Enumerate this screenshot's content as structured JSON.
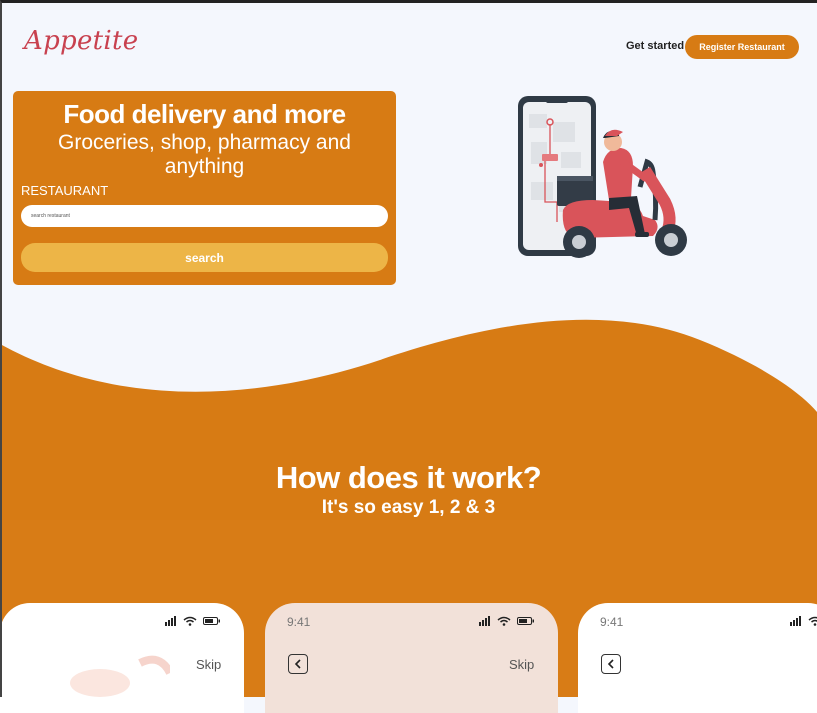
{
  "header": {
    "logo": "Appetite",
    "get_started": "Get started",
    "register_label": "Register Restaurant"
  },
  "hero": {
    "title": "Food delivery and more",
    "subtitle": "Groceries, shop, pharmacy and anything",
    "field_label": "RESTAURANT",
    "search_placeholder": "search restaurant",
    "search_button": "search"
  },
  "how": {
    "title": "How does it work?",
    "subtitle": "It's so easy 1, 2 & 3"
  },
  "phones": [
    {
      "time": "",
      "skip": "Skip"
    },
    {
      "time": "9:41",
      "skip": "Skip"
    },
    {
      "time": "9:41",
      "skip": ""
    }
  ],
  "colors": {
    "accent": "#d77b14",
    "logo": "#c8414f",
    "search_button": "#edb547",
    "background": "#f4f7fd"
  }
}
